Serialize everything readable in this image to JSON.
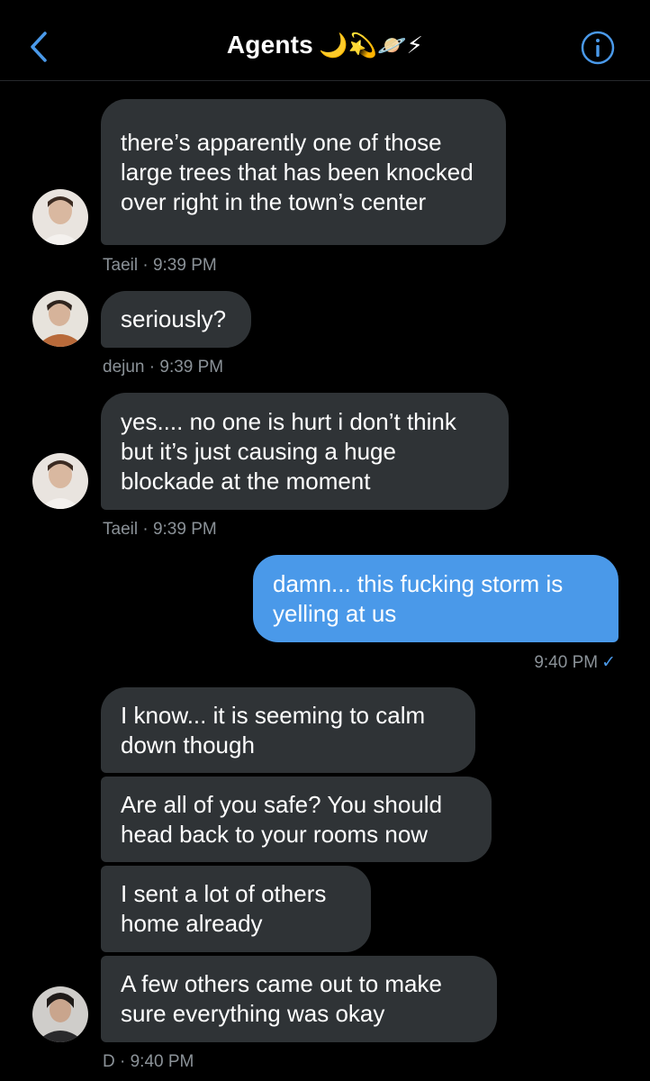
{
  "header": {
    "title": "Agents",
    "title_emoji": "🌙💫🪐⚡",
    "back_icon": "chevron-left-icon",
    "info_icon": "info-circle-icon",
    "accent": "#4a99e9"
  },
  "messages": [
    {
      "sender": "Taeil",
      "text": "there’s apparently one of those large trees that has been knocked over right in the town’s center",
      "meta": "Taeil · 9:39 PM"
    },
    {
      "sender": "dejun",
      "text": "seriously?",
      "meta": "dejun · 9:39 PM"
    },
    {
      "sender": "Taeil",
      "text": "yes.... no one is hurt i don’t think but it’s just causing a huge blockade at the moment",
      "meta": "Taeil · 9:39 PM"
    },
    {
      "sender": "me",
      "text": "damn... this fucking storm is yelling at us",
      "meta": "9:40 PM",
      "status": "✓"
    },
    {
      "sender": "D",
      "text": "I know... it is seeming to calm down though"
    },
    {
      "sender": "D",
      "text": "Are all of you safe? You should head back to your rooms now"
    },
    {
      "sender": "D",
      "text": "I sent a lot of others home already"
    },
    {
      "sender": "D",
      "text": "A few others came out to make sure everything was okay",
      "meta": "D · 9:40 PM"
    }
  ],
  "colors": {
    "background": "#000000",
    "incoming_bubble": "#2f3336",
    "outgoing_bubble": "#4a99e9",
    "meta_text": "#8b9298"
  }
}
